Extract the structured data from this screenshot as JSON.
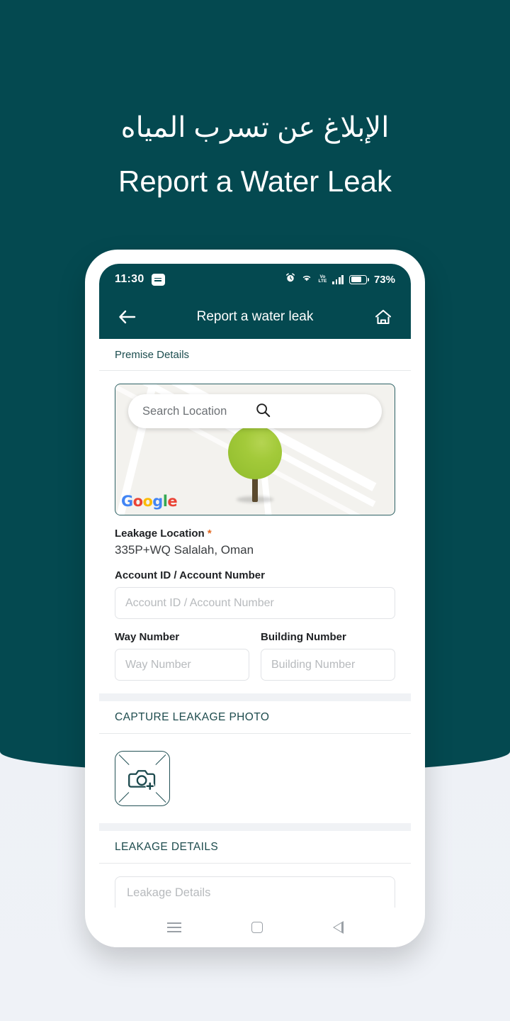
{
  "hero": {
    "title_ar": "الإبلاغ عن تسرب المياه",
    "title_en": "Report a Water Leak"
  },
  "colors": {
    "brand_teal": "#044950",
    "page_background": "#eff2f7",
    "accent_required": "#e2671f",
    "marker_green": "#a3ca3a",
    "section_heading": "#1c4d4f"
  },
  "status_bar": {
    "time": "11:30",
    "notification_icon": "note-icon",
    "alarm_icon": "alarm-icon",
    "wifi_icon": "wifi-icon",
    "volte_top": "Vo",
    "volte_bottom": "LTE",
    "signal_icon": "signal-bars-icon",
    "battery_icon": "battery-icon",
    "battery_percent": "73%"
  },
  "app_bar": {
    "back_icon": "back-arrow-icon",
    "title": "Report a water leak",
    "home_icon": "home-icon"
  },
  "sections": {
    "premise": {
      "heading": "Premise Details"
    },
    "photo": {
      "heading": "CAPTURE LEAKAGE PHOTO",
      "tile_icon": "camera-add-icon"
    },
    "details": {
      "heading": "LEAKAGE DETAILS"
    }
  },
  "map": {
    "search_placeholder": "Search Location",
    "search_icon": "search-icon",
    "marker_icon": "map-pin-icon",
    "attribution": "Google",
    "attribution_letters": [
      {
        "ch": "G",
        "color": "#4285F4"
      },
      {
        "ch": "o",
        "color": "#EA4335"
      },
      {
        "ch": "o",
        "color": "#FBBC05"
      },
      {
        "ch": "g",
        "color": "#4285F4"
      },
      {
        "ch": "l",
        "color": "#34A853"
      },
      {
        "ch": "e",
        "color": "#EA4335"
      }
    ]
  },
  "form": {
    "leakage_location": {
      "label": "Leakage Location",
      "required_mark": "*",
      "value": "335P+WQ Salalah, Oman"
    },
    "account": {
      "label": "Account ID /  Account Number",
      "placeholder": "Account ID /  Account Number",
      "value": ""
    },
    "way_number": {
      "label": "Way Number",
      "placeholder": "Way Number",
      "value": ""
    },
    "building_number": {
      "label": "Building Number",
      "placeholder": "Building Number",
      "value": ""
    },
    "leakage_details": {
      "placeholder": "Leakage Details",
      "value": ""
    }
  },
  "nav_bar": {
    "recents_icon": "menu-icon",
    "home_icon": "square-home-icon",
    "back_icon": "triangle-back-icon"
  }
}
